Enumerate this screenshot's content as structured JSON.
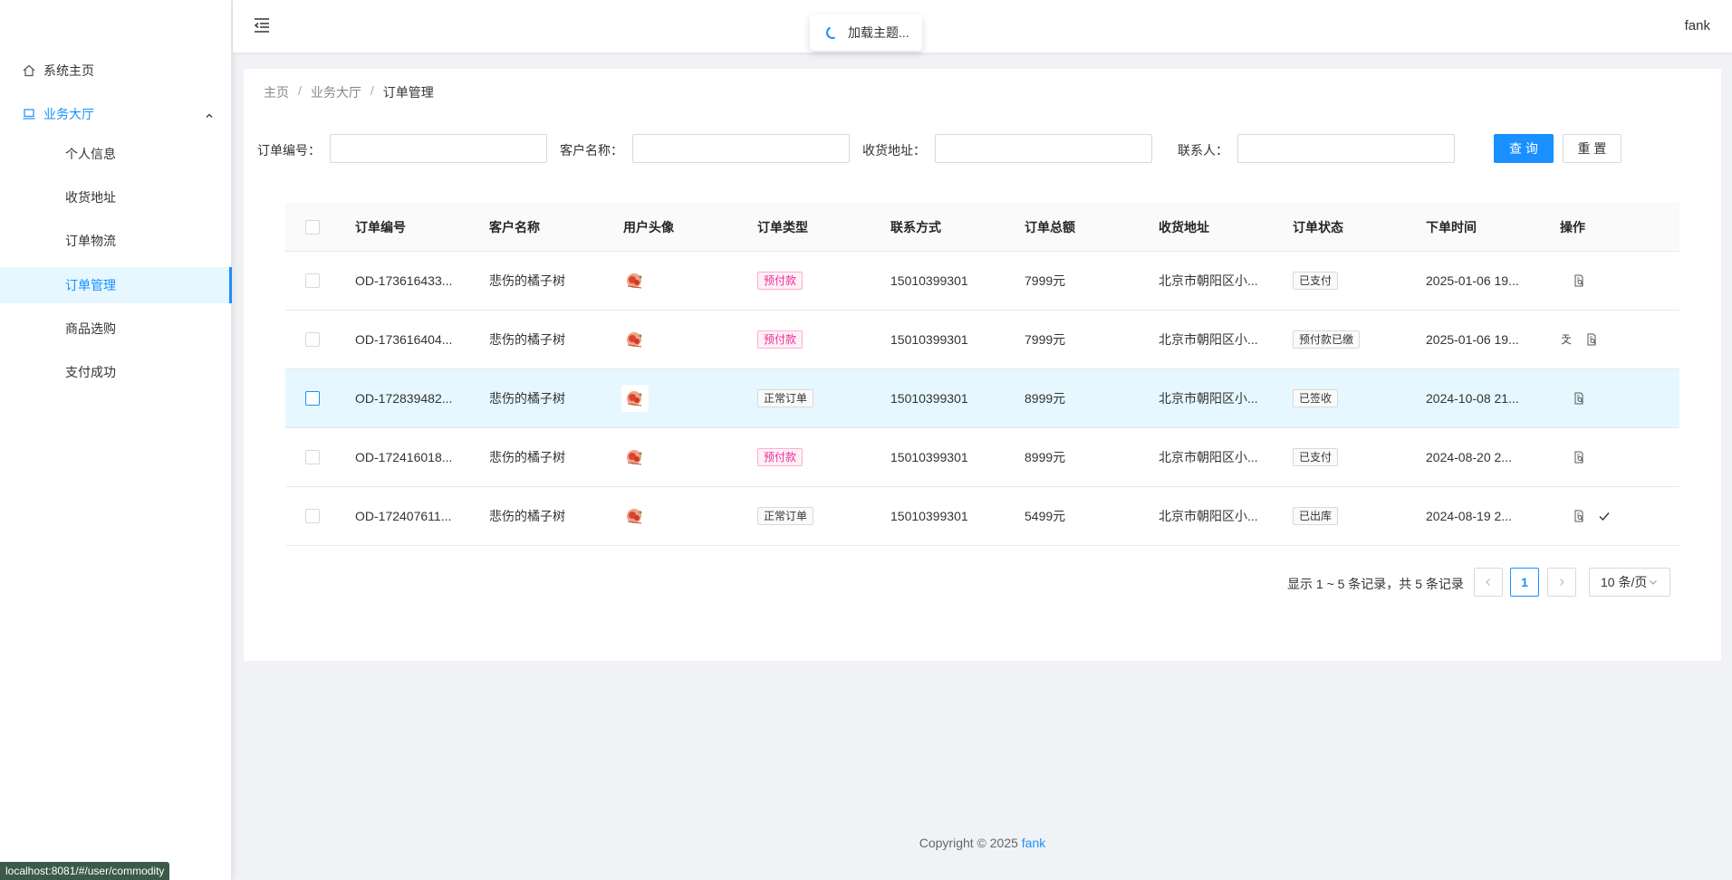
{
  "sidebar": {
    "items": [
      {
        "label": "系统主页",
        "icon": "home-icon"
      },
      {
        "label": "业务大厅",
        "icon": "laptop-icon"
      },
      {
        "label": "个人信息"
      },
      {
        "label": "收货地址"
      },
      {
        "label": "订单物流"
      },
      {
        "label": "订单管理"
      },
      {
        "label": "商品选购"
      },
      {
        "label": "支付成功"
      }
    ]
  },
  "header": {
    "username": "fank",
    "toast": "加载主题..."
  },
  "breadcrumb": [
    "主页",
    "业务大厅",
    "订单管理"
  ],
  "breadcrumb_sep": "/",
  "search": {
    "fields": [
      {
        "label": "订单编号：",
        "value": ""
      },
      {
        "label": "客户名称：",
        "value": ""
      },
      {
        "label": "收货地址：",
        "value": ""
      },
      {
        "label": "联系人：",
        "value": ""
      }
    ],
    "query_label": "查 询",
    "reset_label": "重 置"
  },
  "table": {
    "headers": [
      "订单编号",
      "客户名称",
      "用户头像",
      "订单类型",
      "联系方式",
      "订单总额",
      "收货地址",
      "订单状态",
      "下单时间",
      "操作"
    ],
    "rows": [
      {
        "id": "OD-173616433...",
        "customer": "悲伤的橘子树",
        "type": "预付款",
        "type_style": "pink",
        "phone": "15010399301",
        "amount": "7999元",
        "address": "北京市朝阳区小...",
        "status": "已支付",
        "time": "2025-01-06 19...",
        "actions": [
          "view-icon"
        ]
      },
      {
        "id": "OD-173616404...",
        "customer": "悲伤的橘子树",
        "type": "预付款",
        "type_style": "pink",
        "phone": "15010399301",
        "amount": "7999元",
        "address": "北京市朝阳区小...",
        "status": "预付款已缴",
        "time": "2025-01-06 19...",
        "actions": [
          "pay-icon",
          "view-icon"
        ]
      },
      {
        "id": "OD-172839482...",
        "customer": "悲伤的橘子树",
        "type": "正常订单",
        "type_style": "default",
        "phone": "15010399301",
        "amount": "8999元",
        "address": "北京市朝阳区小...",
        "status": "已签收",
        "time": "2024-10-08 21...",
        "actions": [
          "view-icon"
        ],
        "highlight": true
      },
      {
        "id": "OD-172416018...",
        "customer": "悲伤的橘子树",
        "type": "预付款",
        "type_style": "pink",
        "phone": "15010399301",
        "amount": "8999元",
        "address": "北京市朝阳区小...",
        "status": "已支付",
        "time": "2024-08-20 2...",
        "actions": [
          "view-icon"
        ]
      },
      {
        "id": "OD-172407611...",
        "customer": "悲伤的橘子树",
        "type": "正常订单",
        "type_style": "default",
        "phone": "15010399301",
        "amount": "5499元",
        "address": "北京市朝阳区小...",
        "status": "已出库",
        "time": "2024-08-19 2...",
        "actions": [
          "view-icon",
          "check-icon"
        ]
      }
    ]
  },
  "pagination": {
    "total_text": "显示 1 ~ 5 条记录，共 5 条记录",
    "current": "1",
    "page_size": "10 条/页"
  },
  "footer": {
    "text": "Copyright © 2025",
    "link": "fank"
  },
  "statusbar": "localhost:8081/#/user/commodity",
  "colors": {
    "primary": "#1890ff",
    "pink_tag": "#eb2f96"
  }
}
